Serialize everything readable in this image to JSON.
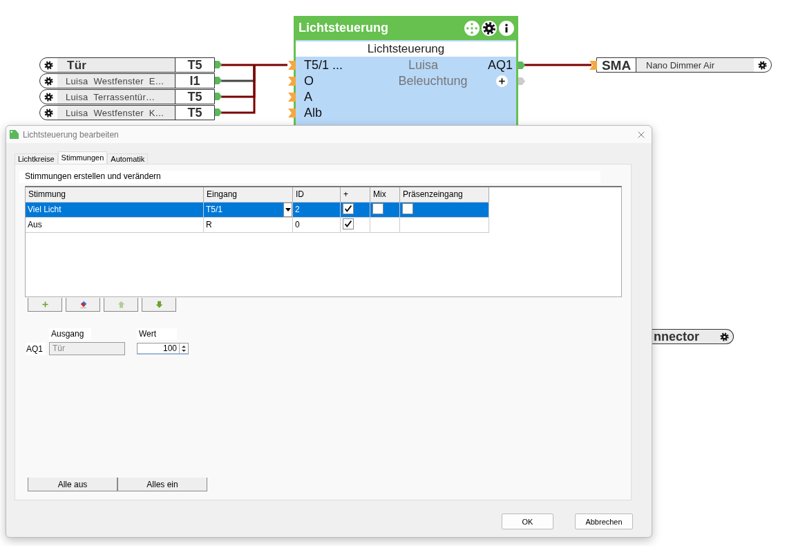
{
  "canvas": {
    "inputs": [
      {
        "name": "Tür",
        "port": "T5",
        "kind": "main",
        "color": "#7a0000"
      },
      {
        "name": "Luisa  Westfenster  E…",
        "port": "I1",
        "kind": "sub",
        "color": "#444444"
      },
      {
        "name": "Luisa  Terrassentür…",
        "port": "T5",
        "kind": "sub",
        "color": "#7a0000"
      },
      {
        "name": "Luisa  Westfenster  K…",
        "port": "T5",
        "kind": "sub",
        "color": "#7a0000"
      }
    ],
    "block": {
      "title": "Lichtsteuerung",
      "subtitle": "Lichtsteuerung",
      "inputs": [
        "T5/1 ...",
        "O",
        "A",
        "Alb"
      ],
      "labels": [
        "Luisa",
        "Beleuchtung"
      ],
      "output": "AQ1"
    },
    "output_block": {
      "port": "SMA",
      "name": "Nano Dimmer Air",
      "color": "#7a0000"
    },
    "connector": {
      "name": "nnector"
    }
  },
  "dialog": {
    "title": "Lichtsteuerung bearbeiten",
    "tabs": [
      {
        "label": "Lichtkreise",
        "selected": false
      },
      {
        "label": "Stimmungen",
        "selected": true
      },
      {
        "label": "Automatik",
        "selected": false
      }
    ],
    "section": "Stimmungen erstellen und verändern",
    "table": {
      "columns": [
        "Stimmung",
        "Eingang",
        "ID",
        "+",
        "Mix",
        "Präsenzeingang"
      ],
      "rows": [
        {
          "stimmung": "Viel Licht",
          "eingang": "T5/1",
          "id": "2",
          "plus": true,
          "mix": false,
          "presence": false,
          "selected": true
        },
        {
          "stimmung": "Aus",
          "eingang": "R",
          "id": "0",
          "plus": true,
          "selected": false
        }
      ]
    },
    "toolbar": [
      {
        "kind": "add",
        "disabled": false
      },
      {
        "kind": "erase",
        "disabled": false
      },
      {
        "kind": "up",
        "disabled": true
      },
      {
        "kind": "down",
        "disabled": false
      }
    ],
    "output": {
      "label_ausgang": "Ausgang",
      "label_wert": "Wert",
      "name": "AQ1",
      "ausgang": "Tür",
      "wert": "100"
    },
    "bulk_buttons": [
      "Alle aus",
      "Alles ein"
    ],
    "buttons": [
      "OK",
      "Abbrechen"
    ]
  }
}
